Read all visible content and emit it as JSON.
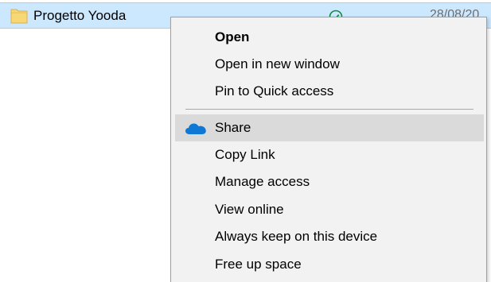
{
  "file_row": {
    "name": "Progetto Yooda",
    "date": "28/08/20",
    "icon": "folder-icon",
    "status_icon": "onedrive-synced-check-icon"
  },
  "context_menu": {
    "groups": [
      {
        "items": [
          {
            "label": "Open",
            "bold": true
          },
          {
            "label": "Open in new window"
          },
          {
            "label": "Pin to Quick access"
          }
        ]
      },
      {
        "items": [
          {
            "label": "Share",
            "icon": "onedrive-cloud-icon",
            "hovered": true
          },
          {
            "label": "Copy Link"
          },
          {
            "label": "Manage access"
          },
          {
            "label": "View online"
          },
          {
            "label": "Always keep on this device"
          },
          {
            "label": "Free up space"
          }
        ]
      }
    ]
  },
  "colors": {
    "selection_bg": "#cce8ff",
    "menu_bg": "#f2f2f2",
    "hover_bg": "#dadada",
    "onedrive_blue": "#0f78d4",
    "sync_green": "#138a3c",
    "folder_yellow": "#f8d775"
  }
}
